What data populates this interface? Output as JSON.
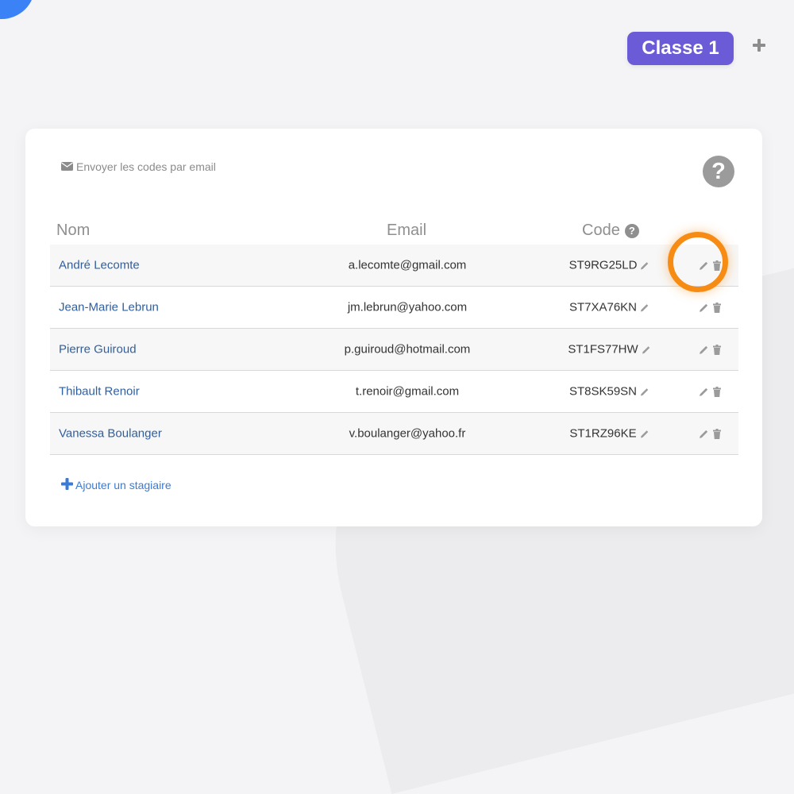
{
  "header": {
    "class_label": "Classe 1",
    "add_class_icon": "plus-icon"
  },
  "card": {
    "send_codes_label": "Envoyer les codes par email",
    "send_codes_icon": "envelope-icon",
    "help_icon": "question-circle-icon",
    "columns": {
      "name": "Nom",
      "email": "Email",
      "code": "Code"
    },
    "rows": [
      {
        "name": "André Lecomte",
        "email": "a.lecomte@gmail.com",
        "code": "ST9RG25LD"
      },
      {
        "name": "Jean-Marie Lebrun",
        "email": "jm.lebrun@yahoo.com",
        "code": "ST7XA76KN"
      },
      {
        "name": "Pierre Guiroud",
        "email": "p.guiroud@hotmail.com",
        "code": "ST1FS77HW"
      },
      {
        "name": "Thibault Renoir",
        "email": "t.renoir@gmail.com",
        "code": "ST8SK59SN"
      },
      {
        "name": "Vanessa Boulanger",
        "email": "v.boulanger@yahoo.fr",
        "code": "ST1RZ96KE"
      }
    ],
    "add_trainee_label": "Ajouter un stagiaire",
    "add_trainee_icon": "plus-icon"
  },
  "colors": {
    "accent_purple": "#6b5bd6",
    "highlight_orange": "#f78c14",
    "link_blue": "#2f5f9f",
    "corner_blue": "#3b82f6"
  }
}
